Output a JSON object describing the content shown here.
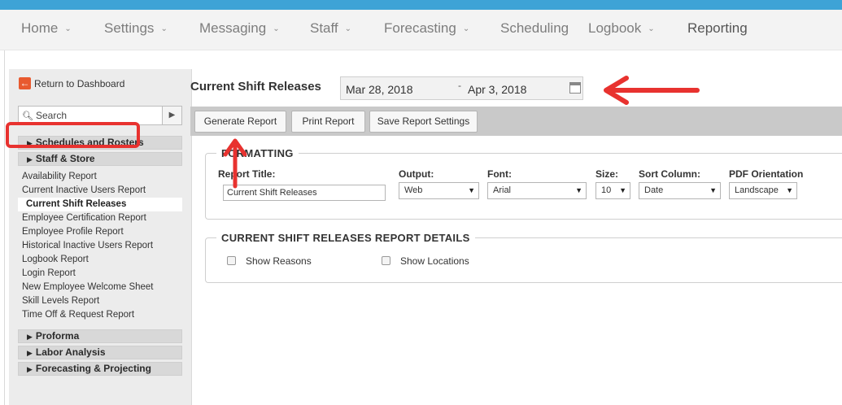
{
  "nav": {
    "items": [
      {
        "label": "Home",
        "chevron": true
      },
      {
        "label": "Settings",
        "chevron": true
      },
      {
        "label": "Messaging",
        "chevron": true
      },
      {
        "label": "Staff",
        "chevron": true
      },
      {
        "label": "Forecasting",
        "chevron": true
      },
      {
        "label": "Scheduling",
        "chevron": false
      },
      {
        "label": "Logbook",
        "chevron": true
      },
      {
        "label": "Reporting",
        "chevron": false
      }
    ],
    "active": "Reporting",
    "chevron_glyph": "⌄"
  },
  "sidebar": {
    "back_label": "Return to Dashboard",
    "search_placeholder": "Search",
    "groups_top": [
      {
        "label": "Schedules and Rosters"
      },
      {
        "label": "Staff & Store"
      }
    ],
    "items": [
      "Availability Report",
      "Current Inactive Users Report",
      "Current Shift Releases",
      "Employee Certification Report",
      "Employee Profile Report",
      "Historical Inactive Users Report",
      "Logbook Report",
      "Login Report",
      "New Employee Welcome Sheet",
      "Skill Levels Report",
      "Time Off & Request Report"
    ],
    "selected": "Current Shift Releases",
    "groups_bottom": [
      {
        "label": "Proforma"
      },
      {
        "label": "Labor Analysis"
      },
      {
        "label": "Forecasting & Projecting"
      }
    ]
  },
  "header": {
    "title": "Current Shift Releases",
    "date_from": "Mar 28, 2018",
    "date_to": "Apr 3, 2018",
    "date_separator": "-"
  },
  "toolbar": {
    "generate": "Generate Report",
    "print": "Print Report",
    "save": "Save Report Settings"
  },
  "formatting": {
    "legend": "FORMATTING",
    "report_title_label": "Report Title:",
    "report_title_value": "Current Shift Releases",
    "output_label": "Output:",
    "output_value": "Web",
    "font_label": "Font:",
    "font_value": "Arial",
    "size_label": "Size:",
    "size_value": "10",
    "sort_label": "Sort Column:",
    "sort_value": "Date",
    "pdf_label": "PDF Orientation",
    "pdf_value": "Landscape"
  },
  "details": {
    "legend": "CURRENT SHIFT RELEASES REPORT DETAILS",
    "show_reasons": "Show Reasons",
    "show_locations": "Show Locations",
    "show_reasons_checked": false,
    "show_locations_checked": false
  },
  "colors": {
    "accent": "#3ea3d6",
    "annotation": "#e8322f",
    "back_icon": "#e85a2f"
  },
  "icons": {
    "back": "arrow-left-icon",
    "search": "search-icon",
    "search_submit": "caret-right-icon",
    "calendar": "calendar-icon",
    "group_expand": "caret-right-icon",
    "select_arrow": "caret-down-icon"
  }
}
